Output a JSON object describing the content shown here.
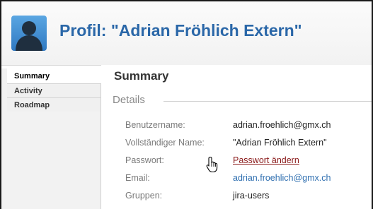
{
  "header": {
    "title": "Profil: \"Adrian Fröhlich Extern\"",
    "avatar_icon": "user-avatar-icon"
  },
  "sidebar": {
    "items": [
      {
        "label": "Summary",
        "active": true
      },
      {
        "label": "Activity",
        "active": false
      },
      {
        "label": "Roadmap",
        "active": false
      }
    ]
  },
  "main": {
    "title": "Summary",
    "section": "Details",
    "fields": [
      {
        "label": "Benutzername:",
        "value": "adrian.froehlich@gmx.ch"
      },
      {
        "label": "Vollständiger Name:",
        "value": "\"Adrian Fröhlich Extern\""
      },
      {
        "label": "Passwort:",
        "value": "Passwort ändern"
      },
      {
        "label": "Email:",
        "value": "adrian.froehlich@gmx.ch"
      },
      {
        "label": "Gruppen:",
        "value": "jira-users"
      }
    ]
  },
  "colors": {
    "title_blue": "#2a67a8",
    "link_blue": "#2f6fb0",
    "visited_link": "#8a1a1a"
  }
}
